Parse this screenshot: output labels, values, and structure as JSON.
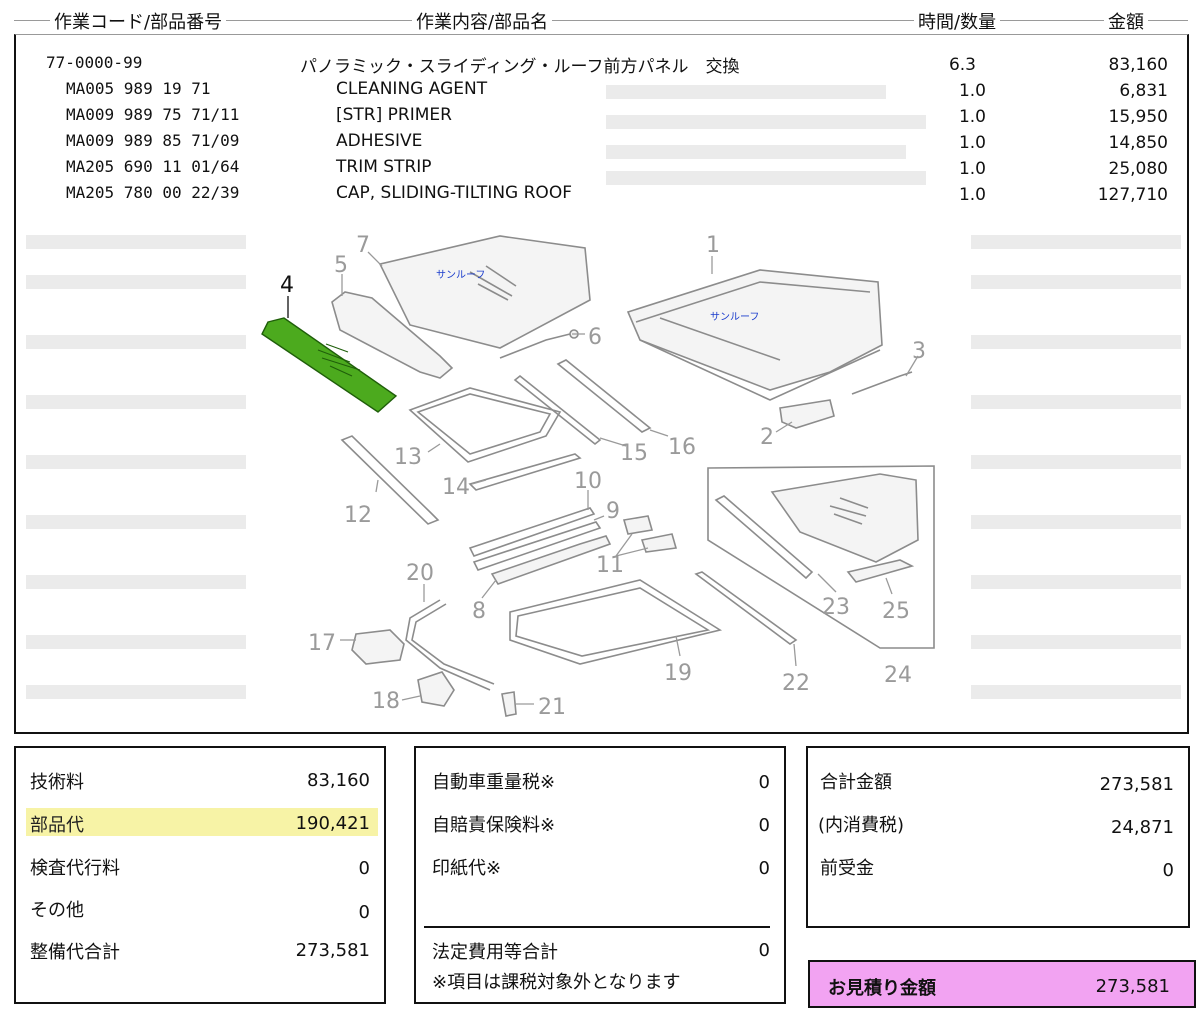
{
  "header": {
    "col_code": "作業コード/部品番号",
    "col_desc": "作業内容/部品名",
    "col_qty": "時間/数量",
    "col_amount": "金額"
  },
  "labor": {
    "code": "77-0000-99",
    "desc": "パノラミック・スライディング・ルーフ前方パネル　交換",
    "qty": "6.3",
    "amount": "83,160"
  },
  "parts": [
    {
      "code": "MA005 989 19 71",
      "name": "CLEANING AGENT",
      "qty": "1.0",
      "amount": "6,831"
    },
    {
      "code": "MA009 989 75 71/11",
      "name": "[STR] PRIMER",
      "qty": "1.0",
      "amount": "15,950"
    },
    {
      "code": "MA009 989 85 71/09",
      "name": "ADHESIVE",
      "qty": "1.0",
      "amount": "14,850"
    },
    {
      "code": "MA205 690 11 01/64",
      "name": "TRIM STRIP",
      "qty": "1.0",
      "amount": "25,080"
    },
    {
      "code": "MA205 780 00 22/39",
      "name": "CAP, SLIDING-TILTING ROOF",
      "qty": "1.0",
      "amount": "127,710"
    }
  ],
  "diagram": {
    "callouts": [
      "1",
      "2",
      "3",
      "4",
      "5",
      "6",
      "7",
      "8",
      "9",
      "10",
      "11",
      "12",
      "13",
      "14",
      "15",
      "16",
      "17",
      "18",
      "19",
      "20",
      "21",
      "22",
      "23",
      "24",
      "25"
    ],
    "note_1": "サンルーフ",
    "note_7": "サンルーフ",
    "highlight_color": "#4caa1e"
  },
  "summary_left": [
    {
      "label": "技術料",
      "value": "83,160"
    },
    {
      "label": "部品代",
      "value": "190,421"
    },
    {
      "label": "検査代行料",
      "value": "0"
    },
    {
      "label": "その他",
      "value": "0"
    },
    {
      "label": "整備代合計",
      "value": "273,581"
    }
  ],
  "summary_mid": [
    {
      "label": "自動車重量税※",
      "value": "0"
    },
    {
      "label": "自賠責保険料※",
      "value": "0"
    },
    {
      "label": "印紙代※",
      "value": "0"
    },
    {
      "label": "法定費用等合計",
      "value": "0"
    }
  ],
  "summary_mid_note": "※項目は課税対象外となります",
  "summary_right": [
    {
      "label": "合計金額",
      "value": "273,581"
    },
    {
      "label": "(内消費税)",
      "value": "24,871"
    },
    {
      "label": "前受金",
      "value": "0"
    }
  ],
  "estimate": {
    "label": "お見積り金額",
    "value": "273,581"
  },
  "colors": {
    "parts_highlight": "#f7f3a6",
    "estimate_bg": "#f2a3f2"
  }
}
